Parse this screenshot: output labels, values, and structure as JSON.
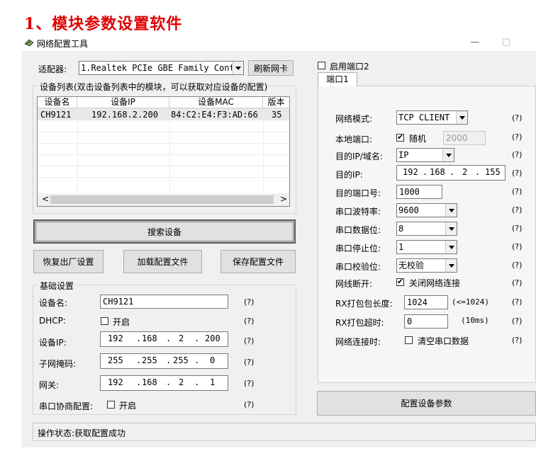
{
  "heading": "1、模块参数设置软件",
  "window": {
    "title": "网络配置工具",
    "minimize_glyph": "—",
    "maximize_glyph": "□"
  },
  "adapter": {
    "label": "适配器:",
    "value": "1.Realtek PCIe GBE Family Cont:",
    "refresh_button": "刷新网卡"
  },
  "device_list": {
    "title": "设备列表(双击设备列表中的模块，可以获取对应设备的配置)",
    "columns": [
      "设备名",
      "设备IP",
      "设备MAC",
      "版本"
    ],
    "rows": [
      [
        "CH9121",
        "192.168.2.200",
        "84:C2:E4:F3:AD:66",
        "35"
      ]
    ],
    "scroll_left": "<",
    "scroll_right": ">"
  },
  "buttons": {
    "search": "搜索设备",
    "factory_reset": "恢复出厂设置",
    "load_config": "加载配置文件",
    "save_config": "保存配置文件",
    "apply": "配置设备参数"
  },
  "basic": {
    "title": "基础设置",
    "device_name_label": "设备名:",
    "device_name": "CH9121",
    "dhcp_label": "DHCP:",
    "dhcp_option": "开启",
    "dhcp_checked": false,
    "ip_label": "设备IP:",
    "ip": [
      "192",
      "168",
      "2",
      "200"
    ],
    "mask_label": "子网掩码:",
    "mask": [
      "255",
      "255",
      "255",
      "0"
    ],
    "gateway_label": "网关:",
    "gateway": [
      "192",
      "168",
      "2",
      "1"
    ],
    "negotiate_label": "串口协商配置:",
    "negotiate_option": "开启",
    "negotiate_checked": false,
    "help": "(?)"
  },
  "port": {
    "enable_port2_label": "启用端口2",
    "enable_port2_checked": false,
    "tab_label": "端口1",
    "net_mode_label": "网络模式:",
    "net_mode": "TCP CLIENT",
    "local_port_label": "本地端口:",
    "random_label": "随机",
    "random_checked": true,
    "local_port": "2000",
    "dest_type_label": "目的IP/域名:",
    "dest_type": "IP",
    "dest_ip_label": "目的IP:",
    "dest_ip": [
      "192",
      "168",
      "2",
      "155"
    ],
    "dest_port_label": "目的端口号:",
    "dest_port": "1000",
    "baud_label": "串口波特率:",
    "baud": "9600",
    "data_bits_label": "串口数据位:",
    "data_bits": "8",
    "stop_bits_label": "串口停止位:",
    "stop_bits": "1",
    "parity_label": "串口校验位:",
    "parity": "无校验",
    "disconnect_label": "网线断开:",
    "disconnect_option": "关闭网络连接",
    "disconnect_checked": true,
    "rx_len_label": "RX打包包长度:",
    "rx_len": "1024",
    "rx_len_hint": "(<=1024)",
    "rx_timeout_label": "RX打包超时:",
    "rx_timeout": "0",
    "rx_timeout_hint": "(10ms)",
    "on_connect_label": "网络连接时:",
    "on_connect_option": "清空串口数据",
    "on_connect_checked": false,
    "help": "(?)"
  },
  "status": {
    "text": "操作状态:获取配置成功"
  }
}
